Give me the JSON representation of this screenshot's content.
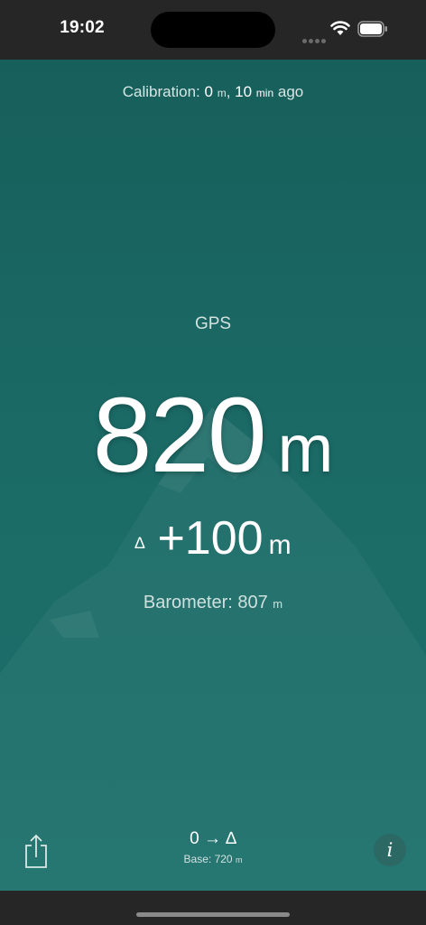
{
  "status_bar": {
    "time": "19:02"
  },
  "calibration": {
    "prefix": "Calibration: ",
    "distance_value": "0",
    "distance_unit": "m",
    "separator": ", ",
    "time_value": "10",
    "time_unit": "min",
    "suffix": " ago"
  },
  "altitude": {
    "source": "GPS",
    "value": "820",
    "unit": "m"
  },
  "delta": {
    "symbol": "∆",
    "value": "+100",
    "unit": "m"
  },
  "barometer": {
    "label": "Barometer: ",
    "value": "807",
    "unit": "m"
  },
  "toolbar": {
    "mode_label": "0 → ∆",
    "base_label": "Base: 720",
    "base_unit": "m",
    "info_label": "i",
    "share_icon": "share-icon"
  },
  "colors": {
    "background_top": "#175f5b",
    "background_bottom": "#1d706c",
    "text": "#ffffff",
    "bars": "#262626"
  }
}
